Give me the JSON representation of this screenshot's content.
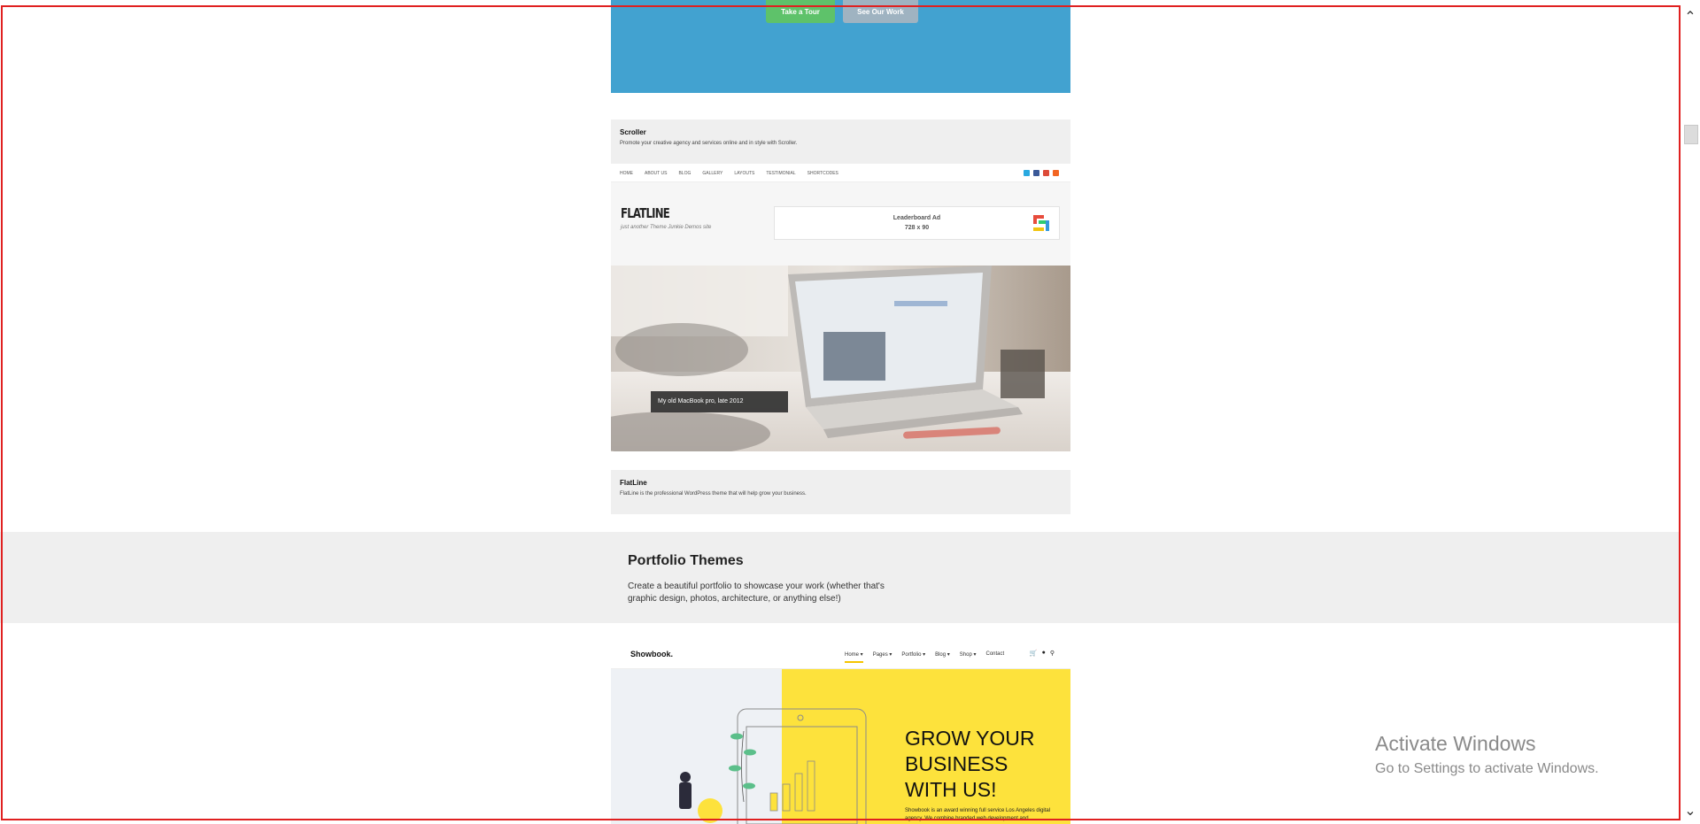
{
  "hero": {
    "tour_label": "Take a Tour",
    "work_label": "See Our Work"
  },
  "scroller": {
    "title": "Scroller",
    "description": "Promote your creative agency and services online and in style with Scroller."
  },
  "flatline_preview": {
    "nav_items": [
      "HOME",
      "ABOUT US",
      "BLOG",
      "GALLERY",
      "LAYOUTS",
      "TESTIMONIAL",
      "SHORTCODES"
    ],
    "logo": "FLATLINE",
    "tagline": "just another Theme Junkie Demos site",
    "ad_line1": "Leaderboard Ad",
    "ad_line2": "728 x 90",
    "image_caption": "My old MacBook pro, late 2012",
    "social_colors": [
      "#2aa9e0",
      "#3b5998",
      "#dd4b39",
      "#f26522"
    ]
  },
  "flatline": {
    "title": "FlatLine",
    "description": "FlatLine is the professional WordPress theme that will help grow your business."
  },
  "portfolio_section": {
    "title": "Portfolio Themes",
    "description": "Create a beautiful portfolio to showcase your work (whether that's graphic design, photos, architecture, or anything else!)"
  },
  "showbook_preview": {
    "logo": "Showbook.",
    "menu": [
      "Home ▾",
      "Pages ▾",
      "Portfolio ▾",
      "Blog ▾",
      "Shop ▾",
      "Contact"
    ],
    "headline": "GROW YOUR BUSINESS WITH US!",
    "body": "Showbook is an award winning full service Los Angeles digital agency. We combine branded web development and"
  },
  "watermark": {
    "title": "Activate Windows",
    "subtitle": "Go to Settings to activate Windows."
  },
  "colors": {
    "hero_blue": "#42a2d0",
    "tour_green": "#5ec26a",
    "showbook_yellow": "#fde23c",
    "frame_red": "#e02020"
  }
}
